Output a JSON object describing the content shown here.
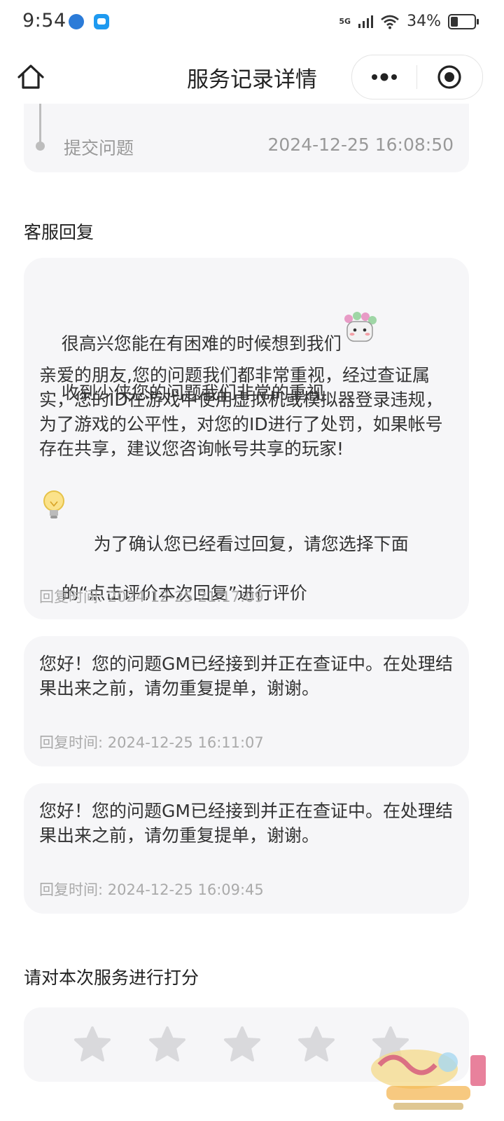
{
  "status_bar": {
    "time": "9:54",
    "signal": "5G",
    "battery": "34%",
    "battery_level": 0.34
  },
  "nav": {
    "title": "服务记录详情",
    "home_icon": "home-icon",
    "more_icon": "more-icon",
    "close_icon": "target-close-icon"
  },
  "timeline": {
    "label": "提交问题",
    "time": "2024-12-25 16:08:50"
  },
  "section_reply": "客服回复",
  "replies": [
    {
      "line1": "很高兴您能在有困难的时候想到我们",
      "line2": "收到少侠您的问题我们非常的重视",
      "paragraph": "亲爱的朋友,您的问题我们都非常重视，经过查证属实，您的ID在游戏中使用虚拟机或模拟器登录违规，为了游戏的公平性，对您的ID进行了处罚，如果帐号存在共享，建议您咨询帐号共享的玩家!",
      "tip_line1": "为了确认您已经看过回复，请您选择下面",
      "tip_line2": "的“点击评价本次回复”进行评价",
      "time": "回复时间:  2024-12-25 21:17:09"
    },
    {
      "text": "您好！您的问题GM已经接到并正在查证中。在处理结果出来之前，请勿重复提单，谢谢。",
      "time": "回复时间:  2024-12-25 16:11:07"
    },
    {
      "text": "您好！您的问题GM已经接到并正在查证中。在处理结果出来之前，请勿重复提单，谢谢。",
      "time": "回复时间:  2024-12-25 16:09:45"
    }
  ],
  "rating": {
    "title": "请对本次服务进行打分",
    "max_stars": 5,
    "selected": 0
  },
  "colors": {
    "card_bg": "#f6f6f8",
    "muted": "#aaaaaa",
    "star": "#d9d9dc"
  }
}
